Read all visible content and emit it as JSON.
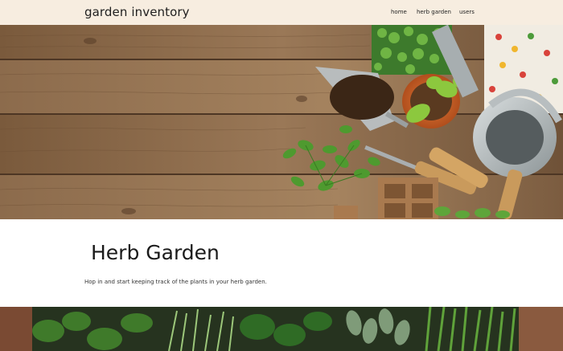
{
  "navbar": {
    "brand": "garden inventory",
    "links": [
      "home",
      "herb garden",
      "users"
    ]
  },
  "hero": {
    "image": "garden-tools-on-wooden-table"
  },
  "intro": {
    "title": "Herb Garden",
    "text": "Hop in and start keeping track of the plants in your herb garden."
  },
  "band": {
    "image": "herb-plants-photo"
  },
  "colors": {
    "navbar_bg": "#f7ede0",
    "wood": "#8a6a4a",
    "leaf": "#4f9a3a"
  }
}
